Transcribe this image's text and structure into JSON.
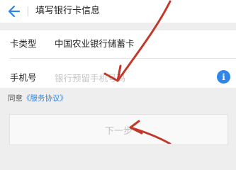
{
  "header": {
    "back_icon": "arrow-left-icon",
    "title": "填写银行卡信息"
  },
  "form": {
    "card_type": {
      "label": "卡类型",
      "value": "中国农业银行储蓄卡"
    },
    "phone": {
      "label": "手机号",
      "placeholder": "银行预留手机号码",
      "info_icon": "info-icon",
      "info_glyph": "i"
    }
  },
  "agreement": {
    "text": "同意",
    "link": "《服务协议》"
  },
  "next_button": {
    "label": "下一步"
  },
  "colors": {
    "accent": "#2f86e8",
    "annotation": "#c0392b",
    "background": "#eeeeee"
  }
}
